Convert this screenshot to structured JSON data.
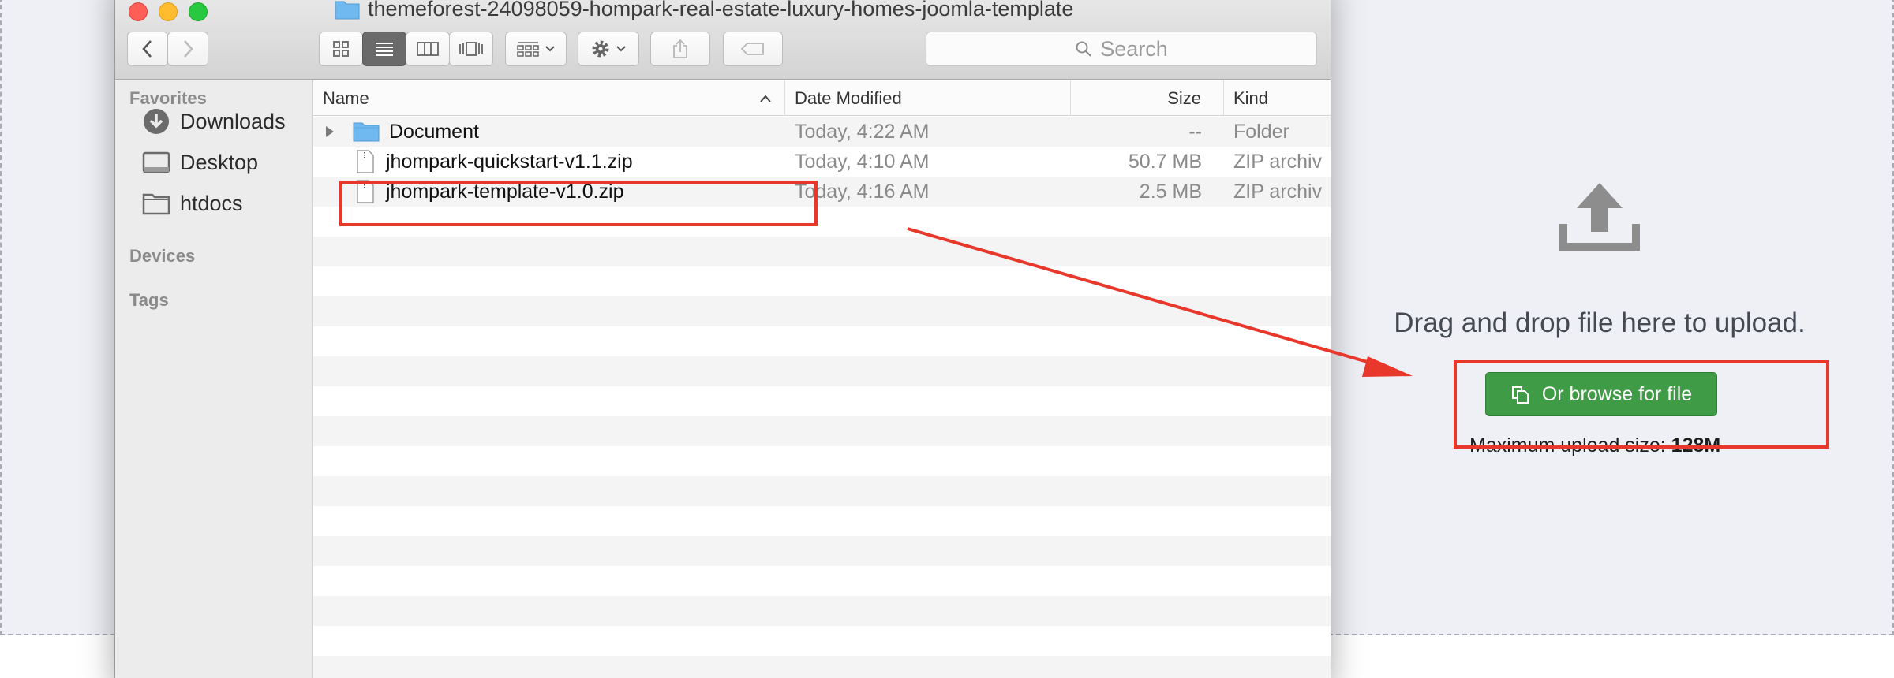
{
  "finder": {
    "title": "themeforest-24098059-hompark-real-estate-luxury-homes-joomla-template",
    "search_placeholder": "Search",
    "sidebar": {
      "favorites_heading": "Favorites",
      "favorites": [
        {
          "label": "Downloads",
          "icon": "downloads-icon"
        },
        {
          "label": "Desktop",
          "icon": "desktop-icon"
        },
        {
          "label": "htdocs",
          "icon": "folder-icon"
        }
      ],
      "devices_heading": "Devices",
      "tags_heading": "Tags"
    },
    "columns": {
      "name": "Name",
      "date": "Date Modified",
      "size": "Size",
      "kind": "Kind"
    },
    "files": [
      {
        "name": "Document",
        "date": "Today, 4:22 AM",
        "size": "--",
        "kind": "Folder",
        "icon": "folder-icon"
      },
      {
        "name": "jhompark-quickstart-v1.1.zip",
        "date": "Today, 4:10 AM",
        "size": "50.7 MB",
        "kind": "ZIP archiv",
        "icon": "zip-file-icon"
      },
      {
        "name": "jhompark-template-v1.0.zip",
        "date": "Today, 4:16 AM",
        "size": "2.5 MB",
        "kind": "ZIP archiv",
        "icon": "zip-file-icon"
      }
    ]
  },
  "upload": {
    "drop_text": "Drag and drop file here to upload.",
    "browse_label": "Or browse for file",
    "max_label": "Maximum upload size:",
    "max_value": "128M"
  },
  "colors": {
    "annotation": "#e8382c",
    "browse_button": "#3f9b45",
    "dropzone_bg": "#eef0f5"
  }
}
